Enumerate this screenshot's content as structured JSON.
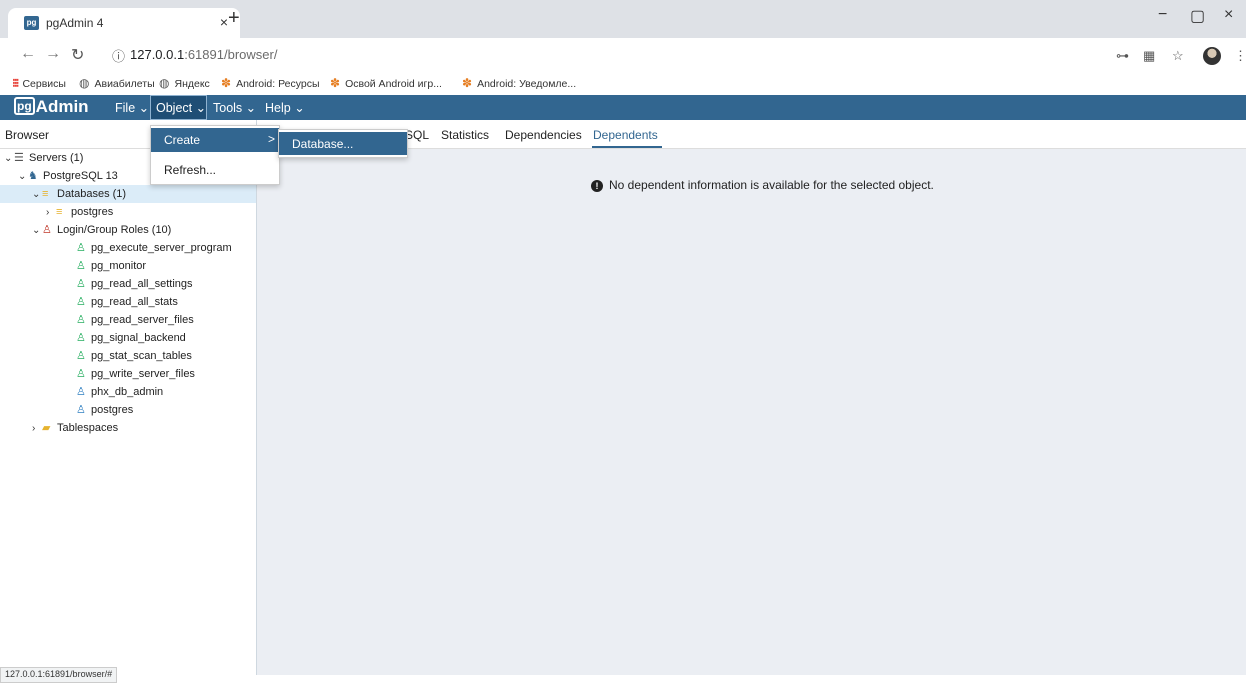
{
  "browser_tab": {
    "title": "pgAdmin 4",
    "favicon_text": "pg",
    "close": "×",
    "new_tab": "+"
  },
  "window_controls": {
    "minimize": "−",
    "maximize": "▢",
    "close": "×"
  },
  "address_bar": {
    "url_host": "127.0.0.1",
    "url_port": ":61891",
    "url_path": "/browser/"
  },
  "bookmarks": [
    {
      "label": "Сервисы",
      "icon": "apps-grid-icon"
    },
    {
      "label": "Авиабилеты",
      "icon": "globe-icon"
    },
    {
      "label": "Яндекс",
      "icon": "globe-icon"
    },
    {
      "label": "Android: Ресурсы",
      "icon": "android-icon"
    },
    {
      "label": "Освой Android игр...",
      "icon": "android-icon"
    },
    {
      "label": "Android: Уведомле...",
      "icon": "android-icon"
    }
  ],
  "navbar": {
    "logo_pg": "pg",
    "logo_text": "Admin",
    "menus": [
      "File",
      "Object",
      "Tools",
      "Help"
    ],
    "color": "#326690"
  },
  "object_menu": {
    "items": [
      "Create",
      "Refresh..."
    ],
    "create_submenu": [
      "Database..."
    ]
  },
  "browser_panel": {
    "title": "Browser",
    "tree": [
      {
        "label": "Servers (1)",
        "icon": "servers-icon"
      },
      {
        "label": "PostgreSQL 13",
        "icon": "postgres-elephant-icon"
      },
      {
        "label": "Databases (1)",
        "icon": "databases-icon"
      },
      {
        "label": "postgres",
        "icon": "database-icon"
      },
      {
        "label": "Login/Group Roles (10)",
        "icon": "roles-icon"
      },
      {
        "label": "pg_execute_server_program",
        "icon": "group-role-icon"
      },
      {
        "label": "pg_monitor",
        "icon": "group-role-icon"
      },
      {
        "label": "pg_read_all_settings",
        "icon": "group-role-icon"
      },
      {
        "label": "pg_read_all_stats",
        "icon": "group-role-icon"
      },
      {
        "label": "pg_read_server_files",
        "icon": "group-role-icon"
      },
      {
        "label": "pg_signal_backend",
        "icon": "group-role-icon"
      },
      {
        "label": "pg_stat_scan_tables",
        "icon": "group-role-icon"
      },
      {
        "label": "pg_write_server_files",
        "icon": "group-role-icon"
      },
      {
        "label": "phx_db_admin",
        "icon": "login-role-icon"
      },
      {
        "label": "postgres",
        "icon": "login-role-icon"
      },
      {
        "label": "Tablespaces",
        "icon": "tablespaces-icon"
      }
    ]
  },
  "main_panel": {
    "tabs": [
      "SQL",
      "Statistics",
      "Dependencies",
      "Dependents"
    ],
    "active_tab": "Dependents",
    "message": "No dependent information is available for the selected object."
  },
  "status_bar": {
    "url": "127.0.0.1:61891/browser/#"
  }
}
